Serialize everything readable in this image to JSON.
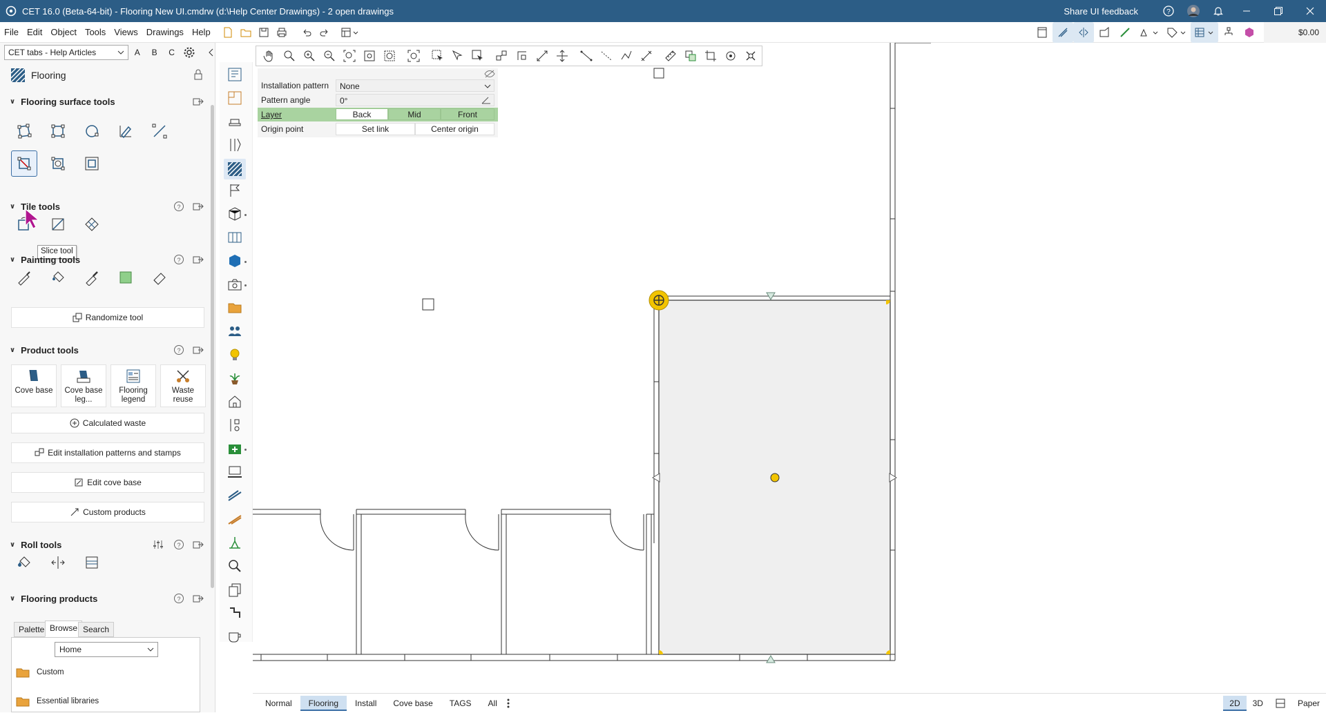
{
  "window": {
    "title": "CET 16.0 (Beta-64-bit) - Flooring New UI.cmdrw (d:\\Help Center Drawings) - 2  open drawings",
    "feedback": "Share UI feedback"
  },
  "menu": [
    "File",
    "Edit",
    "Object",
    "Tools",
    "Views",
    "Drawings",
    "Help"
  ],
  "cost": "$0.00",
  "left_panel": {
    "tab_select": "CET tabs - Help Articles",
    "letters": [
      "A",
      "B",
      "C"
    ],
    "header": "Flooring",
    "tooltip": "Slice tool",
    "sections": {
      "surface": "Flooring surface tools",
      "tile": "Tile tools",
      "painting": "Painting tools",
      "product": "Product tools",
      "roll": "Roll tools",
      "products": "Flooring products"
    },
    "randomize": "Randomize tool",
    "product_tiles": [
      {
        "label": "Cove base"
      },
      {
        "label": "Cove base leg..."
      },
      {
        "label": "Flooring legend"
      },
      {
        "label": "Waste reuse"
      }
    ],
    "buttons": {
      "calculated_waste": "Calculated waste",
      "edit_patterns": "Edit installation patterns and stamps",
      "edit_cove": "Edit cove base",
      "custom_products": "Custom products"
    },
    "product_tabs": [
      "Palette",
      "Browse",
      "Search"
    ],
    "browse_select": "Home",
    "folders": [
      "Custom",
      "Essential libraries"
    ]
  },
  "properties": {
    "installation_pattern_label": "Installation pattern",
    "installation_pattern_value": "None",
    "pattern_angle_label": "Pattern angle",
    "pattern_angle_value": "0°",
    "layer_label": "Layer",
    "layer_options": [
      "Back",
      "Mid",
      "Front"
    ],
    "origin_label": "Origin point",
    "origin_buttons": [
      "Set link",
      "Center origin"
    ]
  },
  "bottom_tabs": [
    "Normal",
    "Flooring",
    "Install",
    "Cove base",
    "TAGS",
    "All"
  ],
  "view_tabs": [
    "2D",
    "3D",
    "Paper"
  ],
  "colors": {
    "titlebar": "#2c5d86",
    "accent": "#3a6ea5",
    "room_fill": "#efefef",
    "layer_green": "#a9d3a0",
    "handle": "#f2c400"
  }
}
